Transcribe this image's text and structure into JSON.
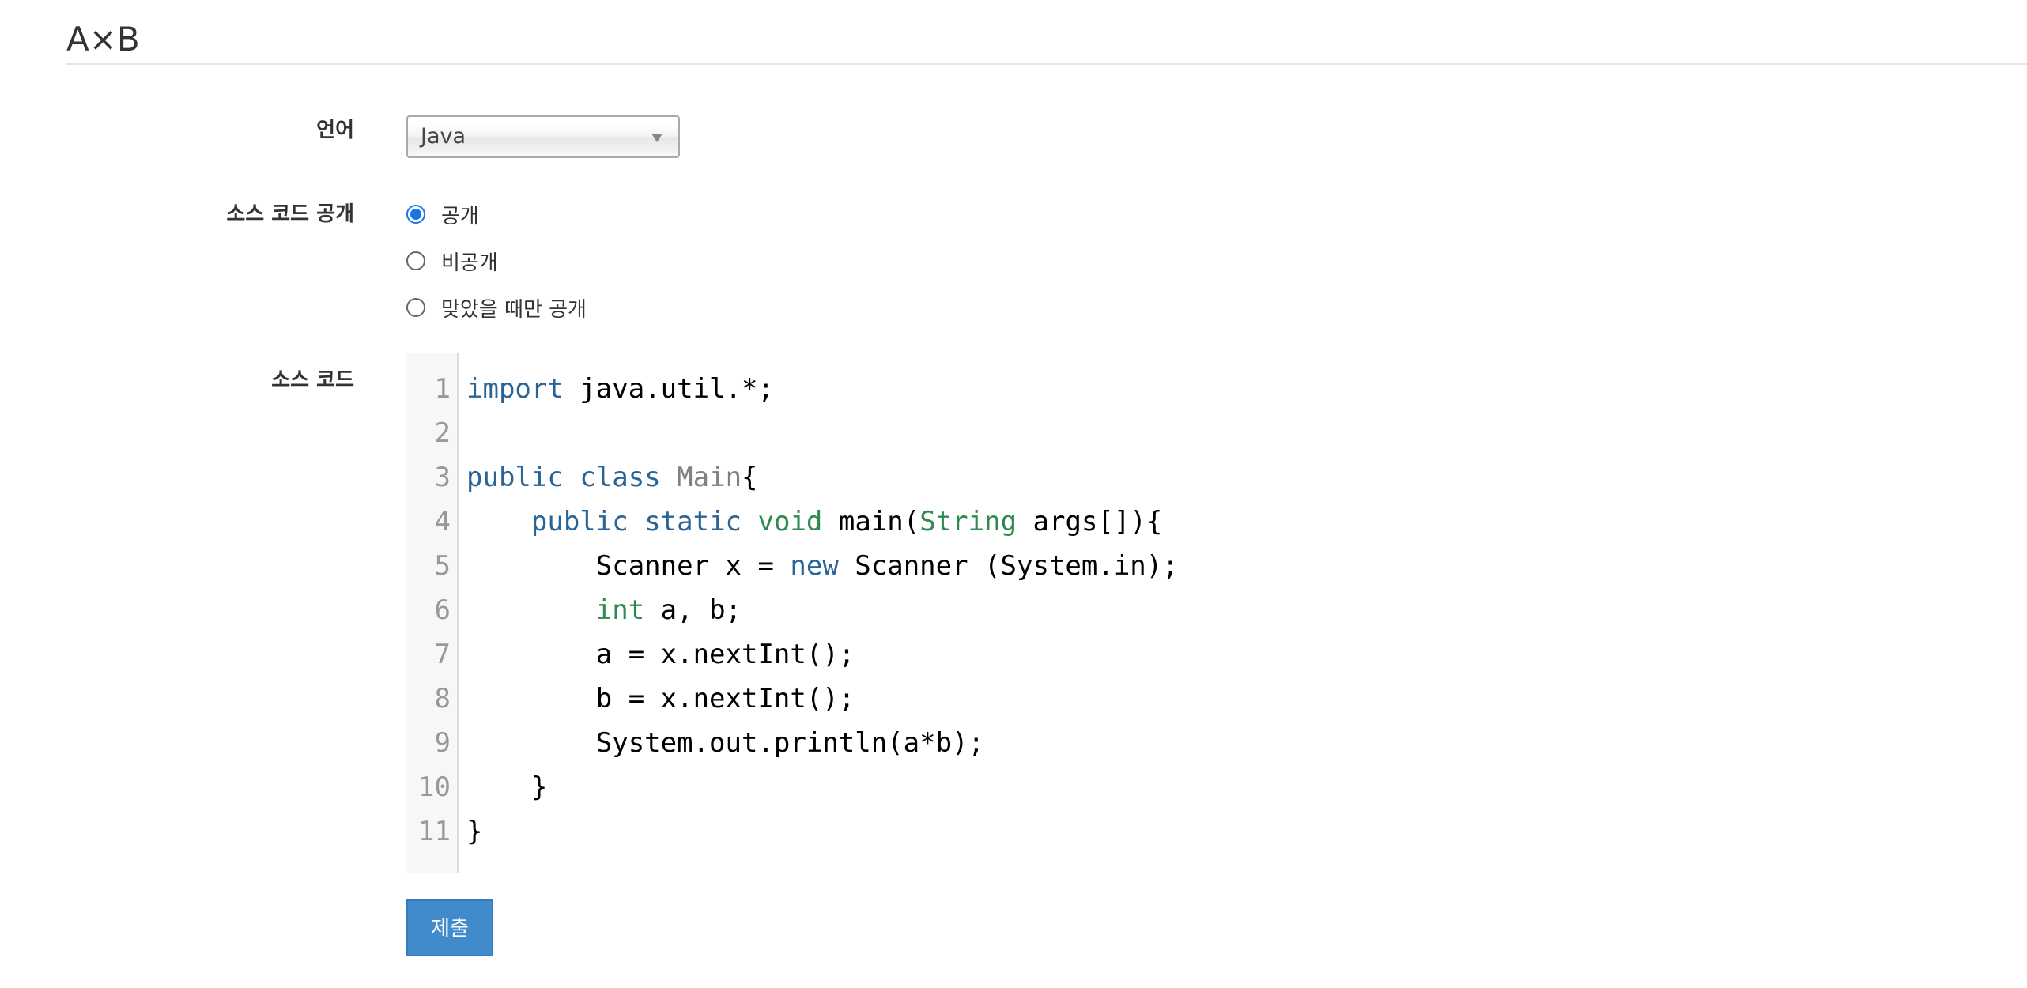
{
  "page": {
    "title": "A×B"
  },
  "form": {
    "language_label": "언어",
    "language_value": "Java",
    "visibility_label": "소스 코드 공개",
    "visibility_options": [
      {
        "label": "공개",
        "checked": true
      },
      {
        "label": "비공개",
        "checked": false
      },
      {
        "label": "맞았을 때만 공개",
        "checked": false
      }
    ],
    "source_label": "소스 코드",
    "submit_label": "제출"
  },
  "editor": {
    "line_numbers": [
      "1",
      "2",
      "3",
      "4",
      "5",
      "6",
      "7",
      "8",
      "9",
      "10",
      "11"
    ],
    "lines": [
      [
        {
          "t": "import",
          "c": "kw"
        },
        {
          "t": " java.util.*;",
          "c": ""
        }
      ],
      [],
      [
        {
          "t": "public",
          "c": "kw"
        },
        {
          "t": " ",
          "c": ""
        },
        {
          "t": "class",
          "c": "kw"
        },
        {
          "t": " ",
          "c": ""
        },
        {
          "t": "Main",
          "c": "df"
        },
        {
          "t": "{",
          "c": ""
        }
      ],
      [
        {
          "t": "    ",
          "c": ""
        },
        {
          "t": "public",
          "c": "kw"
        },
        {
          "t": " ",
          "c": ""
        },
        {
          "t": "static",
          "c": "kw"
        },
        {
          "t": " ",
          "c": ""
        },
        {
          "t": "void",
          "c": "ty"
        },
        {
          "t": " main(",
          "c": ""
        },
        {
          "t": "String",
          "c": "ty"
        },
        {
          "t": " args[]){",
          "c": ""
        }
      ],
      [
        {
          "t": "        Scanner x = ",
          "c": ""
        },
        {
          "t": "new",
          "c": "kw"
        },
        {
          "t": " Scanner (System.in);",
          "c": ""
        }
      ],
      [
        {
          "t": "        ",
          "c": ""
        },
        {
          "t": "int",
          "c": "ty"
        },
        {
          "t": " a, b;",
          "c": ""
        }
      ],
      [
        {
          "t": "        a = x.nextInt();",
          "c": ""
        }
      ],
      [
        {
          "t": "        b = x.nextInt();",
          "c": ""
        }
      ],
      [
        {
          "t": "        System.out.println(a*b);",
          "c": ""
        }
      ],
      [
        {
          "t": "    }",
          "c": ""
        }
      ],
      [
        {
          "t": "}",
          "c": ""
        }
      ]
    ]
  },
  "colors": {
    "keyword": "#2a6496",
    "type": "#2f8a4f",
    "def": "#808080",
    "accent": "#428bca",
    "radio_checked": "#1a73e8"
  }
}
